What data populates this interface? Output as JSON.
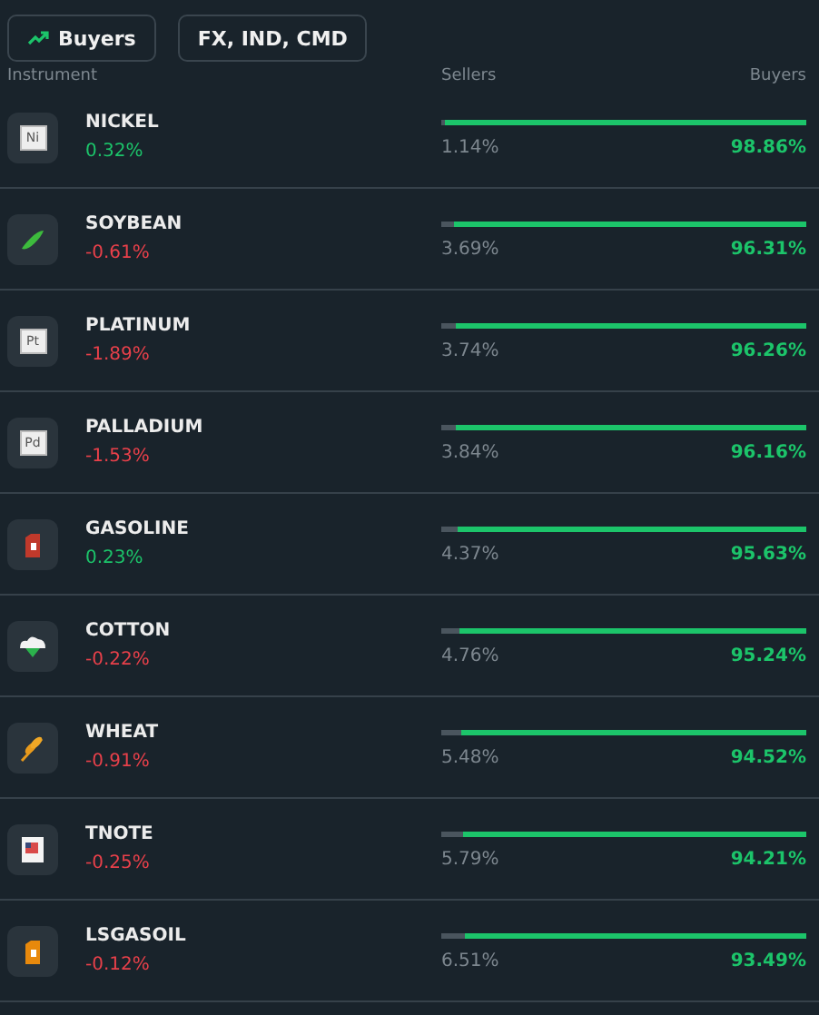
{
  "filters": [
    {
      "kind": "trend",
      "label": "Buyers"
    },
    {
      "kind": "plain",
      "label": "FX, IND, CMD"
    }
  ],
  "columns": {
    "instrument": "Instrument",
    "sellers": "Sellers",
    "buyers": "Buyers"
  },
  "rows": [
    {
      "icon": {
        "kind": "element",
        "symbol": "Ni"
      },
      "name": "NICKEL",
      "change": "0.32%",
      "rising": true,
      "level": 0.9886,
      "sellers": "1.14%",
      "buyers": "98.86%"
    },
    {
      "icon": {
        "kind": "soybean"
      },
      "name": "SOYBEAN",
      "change": "-0.61%",
      "rising": false,
      "level": 0.9631,
      "sellers": "3.69%",
      "buyers": "96.31%"
    },
    {
      "icon": {
        "kind": "element",
        "symbol": "Pt"
      },
      "name": "PLATINUM",
      "change": "-1.89%",
      "rising": false,
      "level": 0.9626,
      "sellers": "3.74%",
      "buyers": "96.26%"
    },
    {
      "icon": {
        "kind": "element",
        "symbol": "Pd"
      },
      "name": "PALLADIUM",
      "change": "-1.53%",
      "rising": false,
      "level": 0.9616,
      "sellers": "3.84%",
      "buyers": "96.16%"
    },
    {
      "icon": {
        "kind": "can",
        "color": "#c0392b"
      },
      "name": "GASOLINE",
      "change": "0.23%",
      "rising": true,
      "level": 0.9563,
      "sellers": "4.37%",
      "buyers": "95.63%"
    },
    {
      "icon": {
        "kind": "cotton"
      },
      "name": "COTTON",
      "change": "-0.22%",
      "rising": false,
      "level": 0.9524,
      "sellers": "4.76%",
      "buyers": "95.24%"
    },
    {
      "icon": {
        "kind": "wheat"
      },
      "name": "WHEAT",
      "change": "-0.91%",
      "rising": false,
      "level": 0.9452,
      "sellers": "5.48%",
      "buyers": "94.52%"
    },
    {
      "icon": {
        "kind": "note"
      },
      "name": "TNOTE",
      "change": "-0.25%",
      "rising": false,
      "level": 0.9421,
      "sellers": "5.79%",
      "buyers": "94.21%"
    },
    {
      "icon": {
        "kind": "can",
        "color": "#e8890c"
      },
      "name": "LSGASOIL",
      "change": "-0.12%",
      "rising": false,
      "level": 0.9349,
      "sellers": "6.51%",
      "buyers": "93.49%"
    }
  ]
}
